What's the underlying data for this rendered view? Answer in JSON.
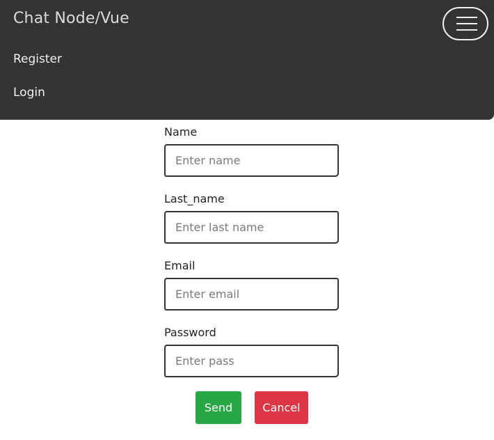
{
  "navbar": {
    "brand": "Chat Node/Vue",
    "links": [
      {
        "label": "Register"
      },
      {
        "label": "Login"
      }
    ],
    "toggler_icon": "menu-icon",
    "background_color": "#333333"
  },
  "form": {
    "fields": [
      {
        "label": "Name",
        "placeholder": "Enter name",
        "value": ""
      },
      {
        "label": "Last_name",
        "placeholder": "Enter last name",
        "value": ""
      },
      {
        "label": "Email",
        "placeholder": "Enter email",
        "value": ""
      },
      {
        "label": "Password",
        "placeholder": "Enter pass",
        "value": ""
      }
    ],
    "send_label": "Send",
    "cancel_label": "Cancel"
  },
  "colors": {
    "send": "#28a745",
    "cancel": "#dc3545"
  }
}
